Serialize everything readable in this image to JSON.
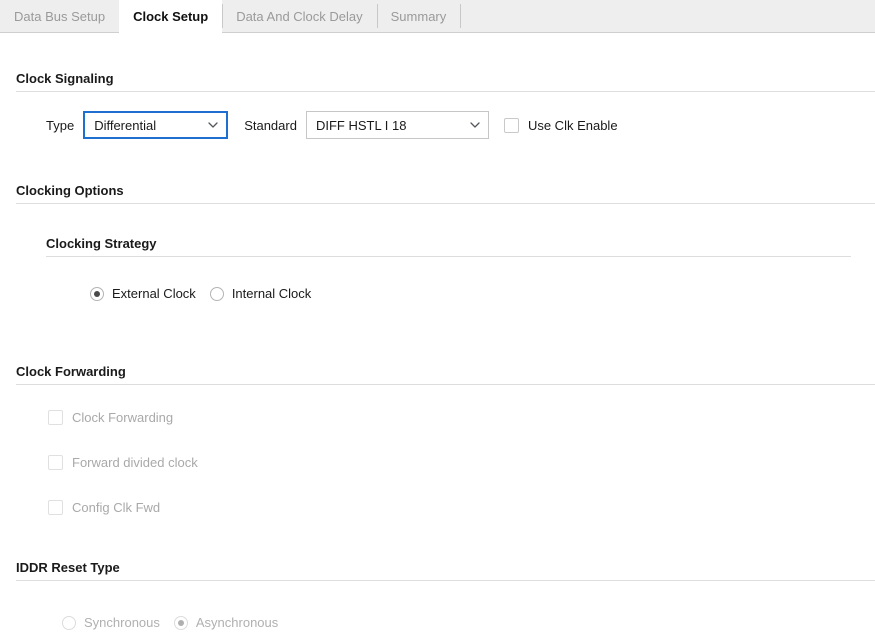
{
  "tabs": [
    {
      "label": "Data Bus Setup",
      "active": false
    },
    {
      "label": "Clock Setup",
      "active": true
    },
    {
      "label": "Data And Clock Delay",
      "active": false
    },
    {
      "label": "Summary",
      "active": false
    }
  ],
  "sections": {
    "clock_signaling": {
      "title": "Clock Signaling",
      "type_label": "Type",
      "type_value": "Differential",
      "standard_label": "Standard",
      "standard_value": "DIFF HSTL I 18",
      "use_clk_enable_label": "Use Clk Enable",
      "use_clk_enable_checked": false
    },
    "clocking_options": {
      "title": "Clocking Options",
      "strategy": {
        "title": "Clocking Strategy",
        "options": [
          {
            "label": "External Clock",
            "selected": true
          },
          {
            "label": "Internal Clock",
            "selected": false
          }
        ]
      }
    },
    "clock_forwarding": {
      "title": "Clock Forwarding",
      "checkboxes": [
        {
          "label": "Clock Forwarding",
          "checked": false,
          "disabled": true
        },
        {
          "label": "Forward divided clock",
          "checked": false,
          "disabled": true
        },
        {
          "label": "Config Clk Fwd",
          "checked": false,
          "disabled": true
        }
      ]
    },
    "iddr_reset_type": {
      "title": "IDDR Reset Type",
      "options": [
        {
          "label": "Synchronous",
          "selected": false,
          "disabled": true
        },
        {
          "label": "Asynchronous",
          "selected": true,
          "disabled": true
        }
      ]
    }
  },
  "colors": {
    "focus_blue": "#1f6fd0",
    "tab_inactive_bg": "#eeeeee",
    "rule": "#dddddd",
    "disabled_text": "#a9a9a9"
  }
}
